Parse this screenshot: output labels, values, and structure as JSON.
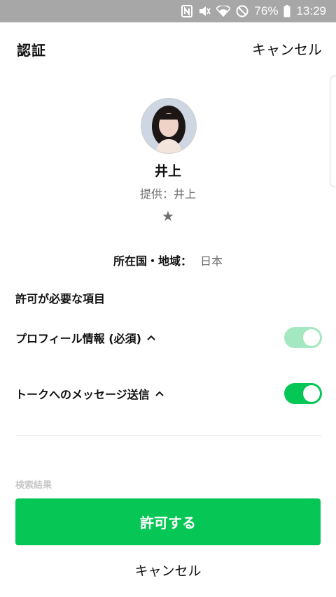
{
  "status_bar": {
    "icons": [
      "nfc-icon",
      "mute-icon",
      "wifi-icon",
      "block-icon",
      "battery-icon"
    ],
    "battery": "76%",
    "time": "13:29"
  },
  "header": {
    "title": "認証",
    "cancel_label": "キャンセル"
  },
  "profile": {
    "name": "井上",
    "provider": "提供：井上",
    "star": "★"
  },
  "country": {
    "label": "所在国・地域：",
    "value": "日本"
  },
  "permissions": {
    "heading": "許可が必要な項目",
    "items": [
      {
        "label": "プロフィール情報 (必須)",
        "enabled": true,
        "disabled_style": true
      },
      {
        "label": "トークへのメッセージ送信",
        "enabled": true,
        "disabled_style": false
      }
    ],
    "faded_label": "検索結果"
  },
  "buttons": {
    "allow": "許可する",
    "cancel": "キャンセル"
  },
  "colors": {
    "accent": "#06c755",
    "accent_light": "#a4e8c2",
    "status_bar": "#a7a7a7"
  }
}
